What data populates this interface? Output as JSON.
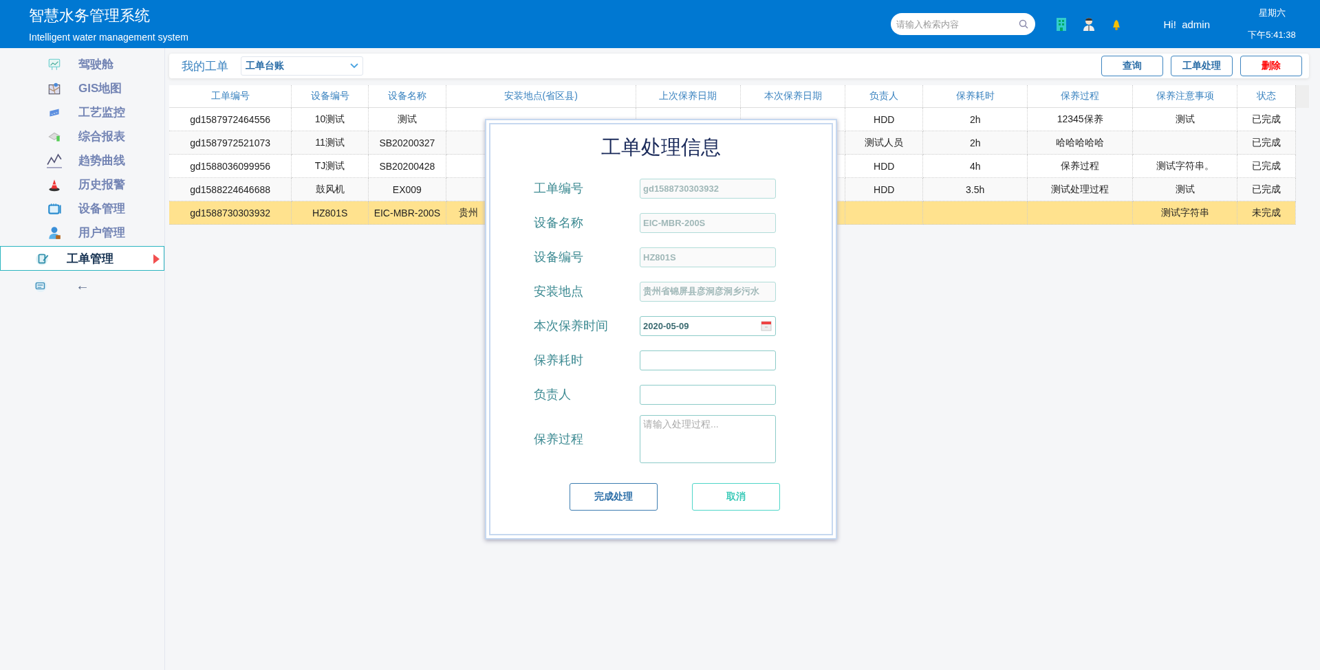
{
  "header": {
    "title": "智慧水务管理系统",
    "subtitle": "Intelligent water management system",
    "search": {
      "placeholder": "请输入检索内容"
    },
    "greeting": "Hi!  admin",
    "weekday": "星期六",
    "time": "下午5:41:38"
  },
  "sidebar": {
    "items": [
      {
        "label": "驾驶舱",
        "kind": "screen",
        "selected": false
      },
      {
        "label": "GIS地图",
        "kind": "map",
        "selected": false
      },
      {
        "label": "工艺监控",
        "kind": "monitor",
        "selected": false
      },
      {
        "label": "综合报表",
        "kind": "report",
        "selected": false
      },
      {
        "label": "趋势曲线",
        "kind": "trend",
        "selected": false
      },
      {
        "label": "历史报警",
        "kind": "alarm",
        "selected": false
      },
      {
        "label": "设备管理",
        "kind": "calendar",
        "selected": false
      },
      {
        "label": "用户管理",
        "kind": "user",
        "selected": false
      },
      {
        "label": "工单管理",
        "kind": "order",
        "selected": true
      },
      {
        "label": "←",
        "kind": "keyboard",
        "selected": false
      }
    ]
  },
  "toolbar": {
    "title": "我的工单",
    "dropdown": "工单台账",
    "buttons": [
      {
        "label": "查询",
        "kind": "normal"
      },
      {
        "label": "工单处理",
        "kind": "normal"
      },
      {
        "label": "删除",
        "kind": "danger"
      }
    ]
  },
  "table": {
    "columns": [
      "工单编号",
      "设备编号",
      "设备名称",
      "安装地点(省区县)",
      "上次保养日期",
      "本次保养日期",
      "负责人",
      "保养耗时",
      "保养过程",
      "保养注意事项",
      "状态"
    ],
    "rows": [
      {
        "selected": false,
        "cells": [
          "gd1587972464556",
          "10测试",
          "测试",
          null,
          null,
          null,
          "HDD",
          "2h",
          "12345保养",
          "测试",
          "已完成"
        ]
      },
      {
        "selected": false,
        "cells": [
          "gd1587972521073",
          "11测试",
          "SB20200327",
          null,
          null,
          null,
          "测试人员",
          "2h",
          "哈哈哈哈哈",
          null,
          "已完成"
        ]
      },
      {
        "selected": false,
        "cells": [
          "gd1588036099956",
          "TJ测试",
          "SB20200428",
          null,
          null,
          null,
          "HDD",
          "4h",
          "保养过程",
          "测试字符串。",
          "已完成"
        ]
      },
      {
        "selected": false,
        "cells": [
          "gd1588224646688",
          "鼓风机",
          "EX009",
          null,
          null,
          null,
          "HDD",
          "3.5h",
          "测试处理过程",
          "测试",
          "已完成"
        ]
      },
      {
        "selected": true,
        "cells": [
          "gd1588730303932",
          "HZ801S",
          "EIC-MBR-200S",
          "贵州",
          null,
          null,
          null,
          null,
          null,
          "测试字符串",
          "未完成"
        ]
      }
    ]
  },
  "dialog": {
    "title": "工单处理信息",
    "fields": [
      {
        "label": "工单编号",
        "kind": "text",
        "disabled": true,
        "value": "gd1588730303932"
      },
      {
        "label": "设备名称",
        "kind": "text",
        "disabled": true,
        "value": "EIC-MBR-200S"
      },
      {
        "label": "设备编号",
        "kind": "text",
        "disabled": true,
        "value": "HZ801S"
      },
      {
        "label": "安装地点",
        "kind": "text",
        "disabled": true,
        "value": "贵州省锦屏县彦洞彦洞乡污水"
      },
      {
        "label": "本次保养时间",
        "kind": "date",
        "disabled": false,
        "value": "2020-05-09"
      },
      {
        "label": "保养耗时",
        "kind": "text",
        "disabled": false
      },
      {
        "label": "负责人",
        "kind": "text",
        "disabled": false
      },
      {
        "label": "保养过程",
        "kind": "textarea",
        "disabled": false,
        "placeholder": "请输入处理过程..."
      }
    ],
    "buttons": [
      {
        "label": "完成处理",
        "kind": "primary"
      },
      {
        "label": "取消",
        "kind": "cancel"
      }
    ]
  }
}
